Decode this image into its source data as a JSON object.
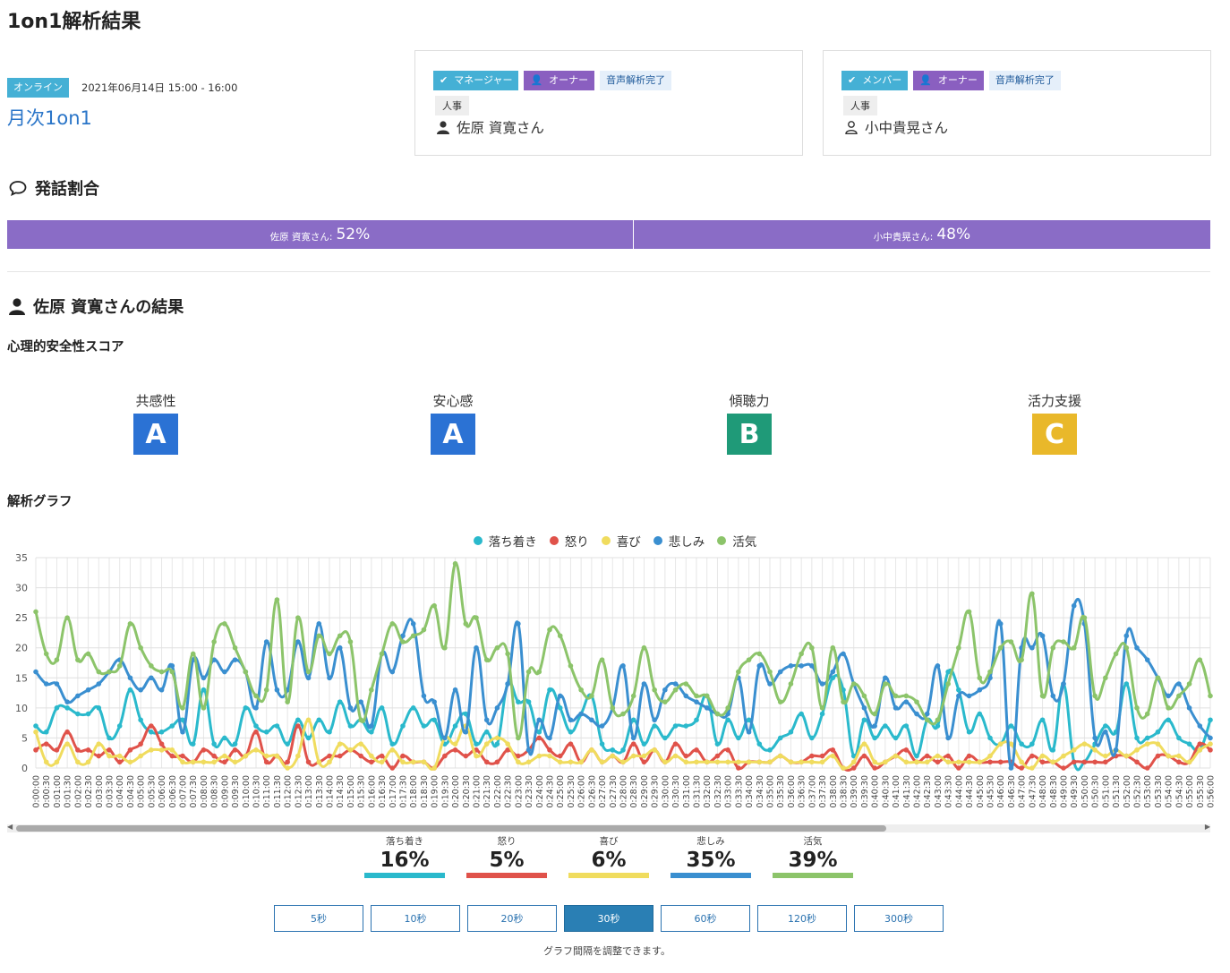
{
  "page": {
    "title": "1on1解析結果"
  },
  "meeting": {
    "mode_tag": "オンライン",
    "datetime": "2021年06月14日 15:00 - 16:00",
    "name": "月次1on1"
  },
  "participants": [
    {
      "role": "マネージャー",
      "owner": "オーナー",
      "voice_status": "音声解析完了",
      "department": "人事",
      "name": "佐原 資寛さん",
      "icon": "person-solid-icon"
    },
    {
      "role": "メンバー",
      "owner": "オーナー",
      "voice_status": "音声解析完了",
      "department": "人事",
      "name": "小中貴晃さん",
      "icon": "person-outline-icon"
    }
  ],
  "speech_ratio": {
    "title": "発話割合",
    "segments": [
      {
        "label": "佐原 資寛さん:",
        "value": "52%",
        "percent": 52
      },
      {
        "label": "小中貴晃さん:",
        "value": "48%",
        "percent": 48
      }
    ]
  },
  "result": {
    "title": "佐原 資寛さんの結果",
    "safety_title": "心理的安全性スコア",
    "scores": [
      {
        "label": "共感性",
        "grade": "A",
        "color": "#2b72d4"
      },
      {
        "label": "安心感",
        "grade": "A",
        "color": "#2b72d4"
      },
      {
        "label": "傾聴力",
        "grade": "B",
        "color": "#1f9a78"
      },
      {
        "label": "活力支援",
        "grade": "C",
        "color": "#e9b82a"
      }
    ],
    "graph_title": "解析グラフ"
  },
  "chart_data": {
    "type": "line",
    "ylim": [
      0,
      35
    ],
    "yticks": [
      0,
      5,
      10,
      15,
      20,
      25,
      30,
      35
    ],
    "x_start": "0:00:00",
    "x_step_seconds": 30,
    "grid": true,
    "legend_position": "top-center",
    "series": [
      {
        "name": "落ち着き",
        "color": "#2ab9cc",
        "values": [
          7,
          6,
          10,
          10,
          9,
          9,
          10,
          5,
          7,
          13,
          8,
          6,
          6,
          7,
          8,
          4,
          13,
          4,
          5,
          4,
          10,
          7,
          6,
          7,
          4,
          8,
          5,
          8,
          6,
          11,
          7,
          8,
          6,
          10,
          4,
          7,
          10,
          7,
          8,
          4,
          7,
          9,
          4,
          6,
          4,
          14,
          11,
          11,
          6,
          13,
          10,
          6,
          9,
          12,
          4,
          3,
          3,
          8,
          4,
          7,
          5,
          7,
          7,
          8,
          12,
          4,
          8,
          5,
          8,
          4,
          3,
          5,
          6,
          9,
          5,
          9,
          15,
          13,
          2,
          8,
          5,
          7,
          5,
          7,
          2,
          8,
          7,
          16,
          13,
          6,
          9,
          5,
          4,
          7,
          4,
          4,
          8,
          3,
          14,
          1,
          1,
          4,
          7,
          6,
          14,
          5,
          5,
          6,
          8,
          5,
          4,
          3,
          8
        ]
      },
      {
        "name": "怒り",
        "color": "#e0524a",
        "values": [
          3,
          4,
          3,
          6,
          3,
          3,
          2,
          3,
          1,
          3,
          4,
          7,
          4,
          2,
          2,
          1,
          3,
          2,
          1,
          3,
          2,
          6,
          1,
          2,
          1,
          7,
          1,
          1,
          2,
          2,
          3,
          2,
          1,
          2,
          0,
          2,
          1,
          1,
          0,
          2,
          3,
          2,
          3,
          1,
          1,
          3,
          2,
          3,
          5,
          3,
          2,
          4,
          1,
          3,
          1,
          2,
          1,
          4,
          1,
          3,
          1,
          4,
          2,
          3,
          1,
          2,
          3,
          0,
          1,
          1,
          1,
          2,
          1,
          1,
          2,
          2,
          3,
          0,
          0,
          2,
          0,
          1,
          2,
          3,
          1,
          2,
          1,
          2,
          0,
          2,
          1,
          1,
          1,
          1,
          0,
          2,
          1,
          1,
          0,
          1,
          1,
          1,
          1,
          2,
          2,
          1,
          0,
          2,
          2,
          1,
          1,
          4,
          3
        ]
      },
      {
        "name": "喜び",
        "color": "#f0dc5e",
        "values": [
          6,
          1,
          1,
          4,
          1,
          1,
          4,
          2,
          2,
          1,
          2,
          3,
          3,
          3,
          1,
          1,
          1,
          1,
          2,
          1,
          2,
          3,
          2,
          2,
          0,
          2,
          8,
          1,
          1,
          4,
          3,
          4,
          2,
          1,
          3,
          1,
          1,
          1,
          0,
          5,
          4,
          7,
          2,
          4,
          5,
          4,
          1,
          1,
          2,
          2,
          1,
          1,
          1,
          3,
          1,
          2,
          1,
          2,
          2,
          3,
          1,
          2,
          1,
          1,
          1,
          1,
          1,
          1,
          1,
          1,
          1,
          2,
          1,
          1,
          1,
          1,
          2,
          0,
          1,
          4,
          1,
          1,
          2,
          1,
          1,
          1,
          2,
          1,
          1,
          1,
          1,
          2,
          4,
          4,
          1,
          0,
          2,
          1,
          2,
          3,
          4,
          3,
          2,
          3,
          2,
          3,
          4,
          4,
          2,
          2,
          1,
          3,
          4
        ]
      },
      {
        "name": "悲しみ",
        "color": "#3a8fd0",
        "values": [
          16,
          14,
          14,
          11,
          12,
          13,
          14,
          16,
          18,
          15,
          13,
          15,
          13,
          17,
          6,
          18,
          15,
          18,
          16,
          18,
          16,
          10,
          21,
          13,
          13,
          21,
          15,
          24,
          15,
          20,
          10,
          11,
          7,
          19,
          16,
          22,
          24,
          12,
          11,
          5,
          13,
          6,
          20,
          8,
          10,
          14,
          24,
          3,
          8,
          5,
          12,
          8,
          9,
          8,
          7,
          10,
          17,
          5,
          14,
          8,
          13,
          14,
          12,
          11,
          10,
          9,
          9,
          15,
          6,
          17,
          14,
          16,
          17,
          17,
          17,
          14,
          16,
          19,
          14,
          10,
          7,
          15,
          10,
          11,
          9,
          9,
          17,
          5,
          12,
          12,
          13,
          15,
          24,
          0,
          20,
          20,
          22,
          12,
          14,
          27,
          24,
          5,
          6,
          3,
          22,
          20,
          18,
          15,
          12,
          14,
          10,
          7,
          5
        ]
      },
      {
        "name": "活気",
        "color": "#8cc46a",
        "values": [
          26,
          19,
          18,
          25,
          18,
          19,
          16,
          16,
          17,
          24,
          20,
          17,
          16,
          16,
          10,
          19,
          10,
          21,
          24,
          20,
          16,
          12,
          13,
          28,
          11,
          25,
          16,
          22,
          19,
          22,
          21,
          8,
          13,
          19,
          24,
          21,
          22,
          23,
          27,
          20,
          34,
          24,
          25,
          18,
          20,
          19,
          5,
          16,
          16,
          23,
          22,
          17,
          13,
          12,
          18,
          10,
          9,
          12,
          20,
          13,
          11,
          13,
          14,
          12,
          12,
          9,
          10,
          16,
          18,
          19,
          16,
          11,
          14,
          19,
          20,
          10,
          20,
          11,
          14,
          12,
          9,
          14,
          12,
          12,
          11,
          8,
          8,
          14,
          20,
          26,
          15,
          16,
          20,
          21,
          18,
          29,
          12,
          20,
          21,
          20,
          25,
          12,
          15,
          19,
          20,
          10,
          9,
          15,
          10,
          12,
          14,
          18,
          12
        ]
      }
    ]
  },
  "summary": [
    {
      "label": "落ち着き",
      "value": "16%",
      "color": "#2ab9cc"
    },
    {
      "label": "怒り",
      "value": "5%",
      "color": "#e0524a"
    },
    {
      "label": "喜び",
      "value": "6%",
      "color": "#f0dc5e"
    },
    {
      "label": "悲しみ",
      "value": "35%",
      "color": "#3a8fd0"
    },
    {
      "label": "活気",
      "value": "39%",
      "color": "#8cc46a"
    }
  ],
  "intervals": {
    "options": [
      "5秒",
      "10秒",
      "20秒",
      "30秒",
      "60秒",
      "120秒",
      "300秒"
    ],
    "selected": "30秒",
    "note": "グラフ間隔を調整できます。"
  }
}
